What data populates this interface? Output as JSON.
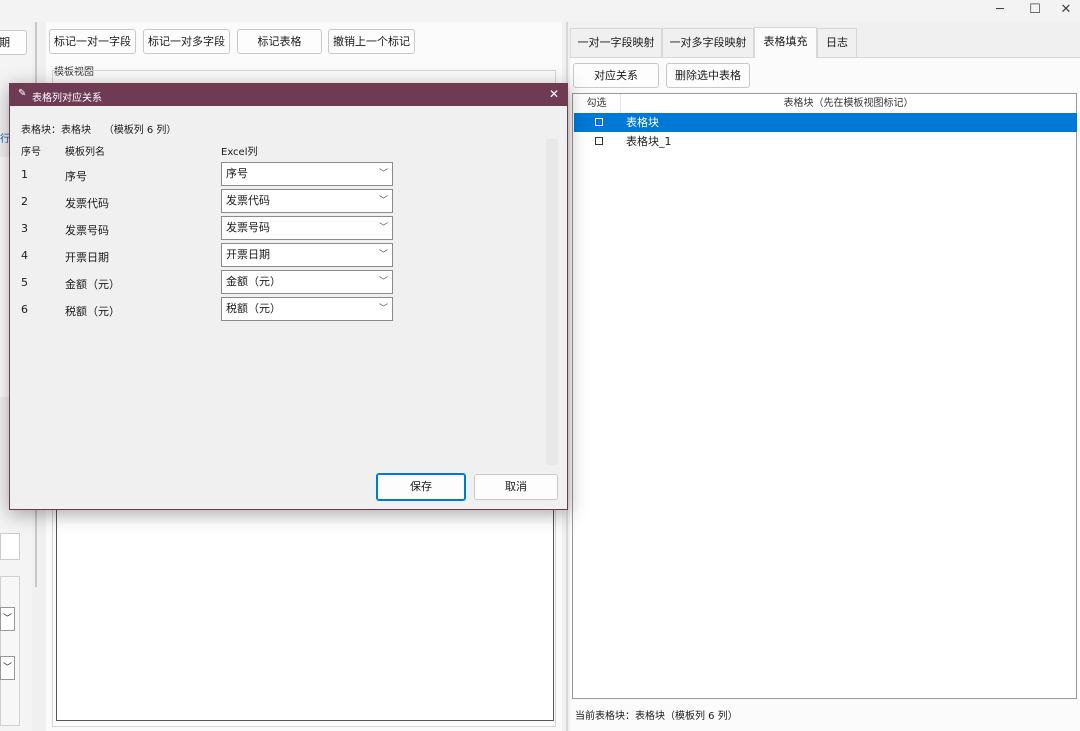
{
  "window": {
    "controls": [
      "─",
      "☐",
      "✕"
    ]
  },
  "left_edge": {
    "partial_button": "期",
    "partial_label": "行"
  },
  "toolbar": {
    "mark_one_to_one": "标记一对一字段",
    "mark_one_to_many": "标记一对多字段",
    "mark_table": "标记表格",
    "undo_mark": "撤销上一个标记"
  },
  "template_view": {
    "label": "模板视图"
  },
  "right_panel": {
    "tabs": [
      "一对一字段映射",
      "一对多字段映射",
      "表格填充",
      "日志"
    ],
    "active_tab": "表格填充",
    "buttons": {
      "mapping": "对应关系",
      "delete_selected": "删除选中表格"
    },
    "columns": [
      "勾选",
      "表格块（先在模板视图标记）"
    ],
    "rows": [
      {
        "name": "表格块",
        "selected": true
      },
      {
        "name": "表格块_1",
        "selected": false
      }
    ],
    "status": "当前表格块：表格块（模板列 6 列）"
  },
  "dialog": {
    "title": "表格列对应关系",
    "close": "✕",
    "info": "表格块：表格块    （模板列 6 列）",
    "headers": {
      "index": "序号",
      "template_col": "模板列名",
      "excel_col": "Excel列"
    },
    "rows": [
      {
        "index": "1",
        "template": "序号",
        "excel": "序号"
      },
      {
        "index": "2",
        "template": "发票代码",
        "excel": "发票代码"
      },
      {
        "index": "3",
        "template": "发票号码",
        "excel": "发票号码"
      },
      {
        "index": "4",
        "template": "开票日期",
        "excel": "开票日期"
      },
      {
        "index": "5",
        "template": "金额（元）",
        "excel": "金额（元）"
      },
      {
        "index": "6",
        "template": "税额（元）",
        "excel": "税额（元）"
      }
    ],
    "save": "保存",
    "cancel": "取消"
  },
  "colors": {
    "dialog_title_bg": "#6e3b52",
    "selection": "#0078d7"
  }
}
